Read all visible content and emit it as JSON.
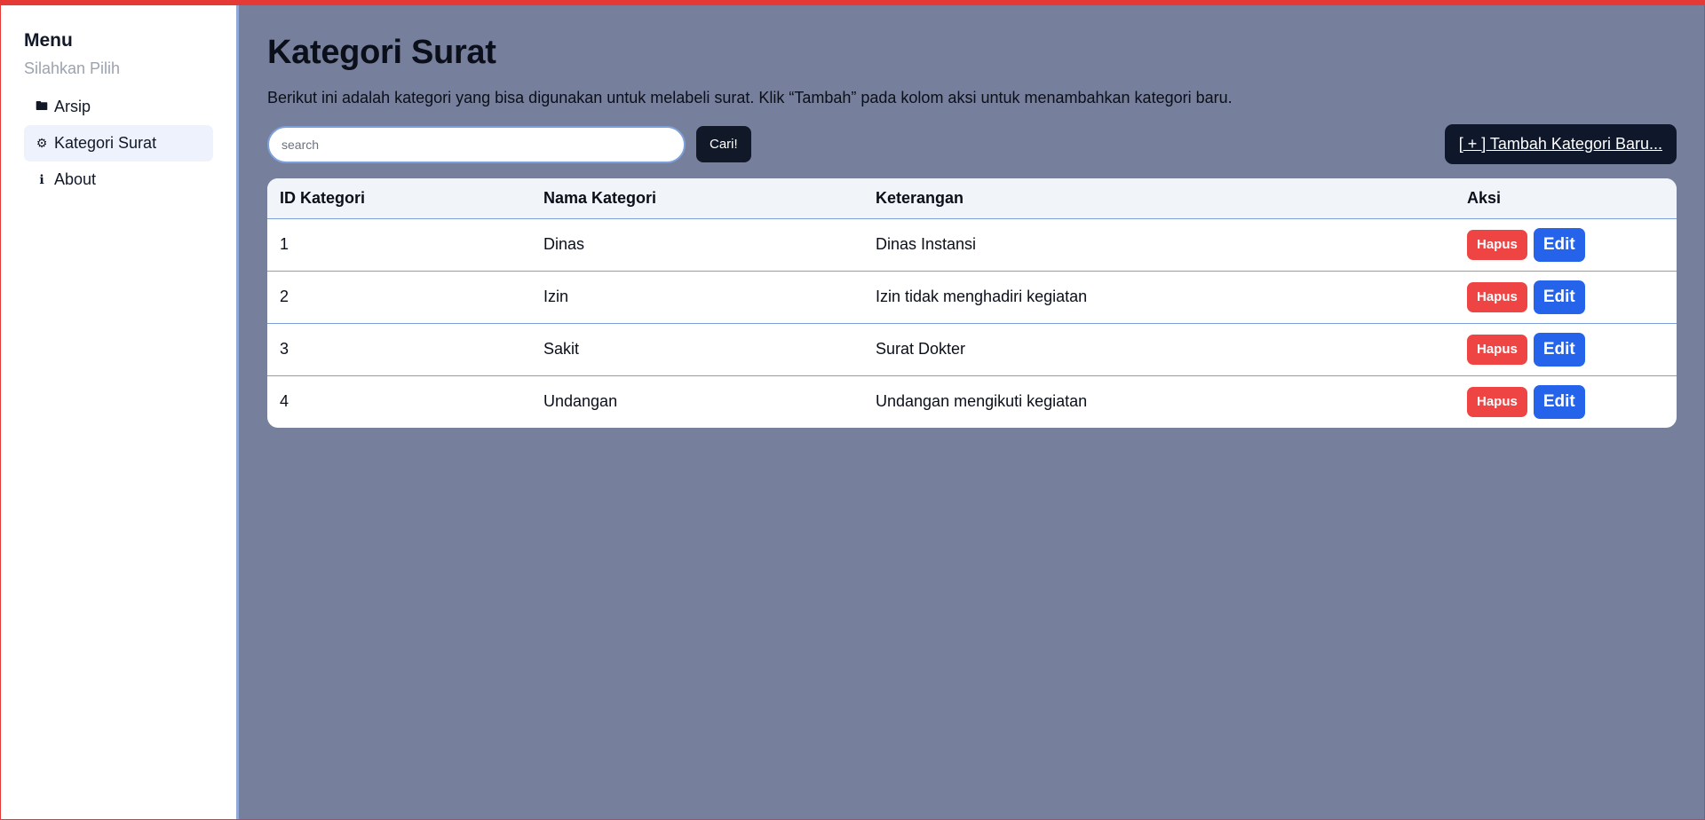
{
  "sidebar": {
    "title": "Menu",
    "subtitle": "Silahkan Pilih",
    "items": [
      {
        "icon": "🖿",
        "label": "Arsip",
        "active": false
      },
      {
        "icon": "⚙",
        "label": "Kategori Surat",
        "active": true
      },
      {
        "icon": "ℹ",
        "label": "About",
        "active": false
      }
    ]
  },
  "main": {
    "title": "Kategori Surat",
    "description": "Berikut ini adalah kategori yang bisa digunakan untuk melabeli surat. Klik “Tambah” pada kolom aksi untuk menambahkan kategori baru.",
    "search": {
      "placeholder": "search",
      "value": "",
      "button_label": "Cari!"
    },
    "add_button_label": "[ + ] Tambah Kategori Baru...",
    "table": {
      "headers": [
        "ID Kategori",
        "Nama Kategori",
        "Keterangan",
        "Aksi"
      ],
      "rows": [
        {
          "id": "1",
          "nama": "Dinas",
          "keterangan": "Dinas Instansi"
        },
        {
          "id": "2",
          "nama": "Izin",
          "keterangan": "Izin tidak menghadiri kegiatan"
        },
        {
          "id": "3",
          "nama": "Sakit",
          "keterangan": "Surat Dokter"
        },
        {
          "id": "4",
          "nama": "Undangan",
          "keterangan": "Undangan mengikuti kegiatan"
        }
      ],
      "hapus_label": "Hapus",
      "edit_label": "Edit"
    }
  },
  "colors": {
    "main_bg": "#767f9c",
    "hapus": "#ef4444",
    "edit": "#2563eb",
    "dark_button": "#111827",
    "frame_border": "#e53935"
  }
}
